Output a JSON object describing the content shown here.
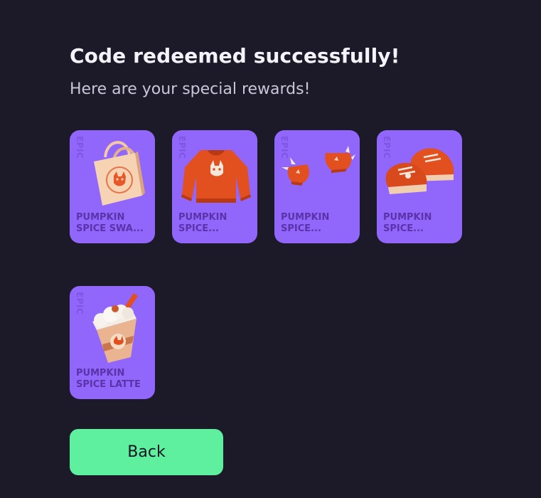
{
  "heading": {
    "title": "Code redeemed successfully!",
    "subtitle": "Here are your special rewards!"
  },
  "rewards": [
    {
      "rarity": "EPIC",
      "name": "PUMPKIN SPICE SWA...",
      "icon": "tote-bag-icon"
    },
    {
      "rarity": "EPIC",
      "name": "PUMPKIN SPICE...",
      "icon": "sweater-icon"
    },
    {
      "rarity": "EPIC",
      "name": "PUMPKIN SPICE...",
      "icon": "spiky-bracelets-icon"
    },
    {
      "rarity": "EPIC",
      "name": "PUMPKIN SPICE...",
      "icon": "sneakers-icon"
    },
    {
      "rarity": "EPIC",
      "name": "PUMPKIN SPICE LATTE",
      "icon": "latte-cup-icon"
    }
  ],
  "actions": {
    "back_label": "Back"
  },
  "colors": {
    "background": "#1c1a29",
    "card": "#9166fb",
    "card_text": "#5a33a8",
    "button": "#5eef9f"
  }
}
